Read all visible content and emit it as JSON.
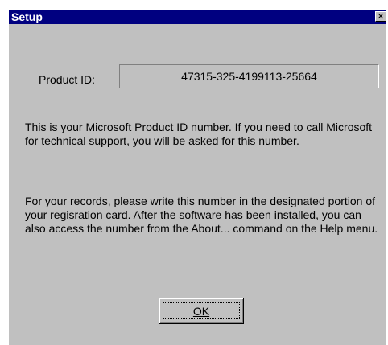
{
  "window": {
    "title": "Setup",
    "close_glyph": "✕"
  },
  "product": {
    "label": "Product ID:",
    "value": "47315-325-4199113-25664"
  },
  "body": {
    "paragraph_1": "This is your Microsoft Product ID number. If you need to call Microsoft for technical support, you will be asked for this number.",
    "paragraph_2": "For your records, please write this number in the designated portion of your regisration card. After the software has been installed, you can also access the number from the About... command on the Help menu."
  },
  "buttons": {
    "ok_label": "OK"
  },
  "colors": {
    "titlebar": "#000080",
    "dialog_face": "#c0c0c0",
    "title_text": "#ffffff"
  },
  "icons": {
    "close": "close-icon"
  }
}
